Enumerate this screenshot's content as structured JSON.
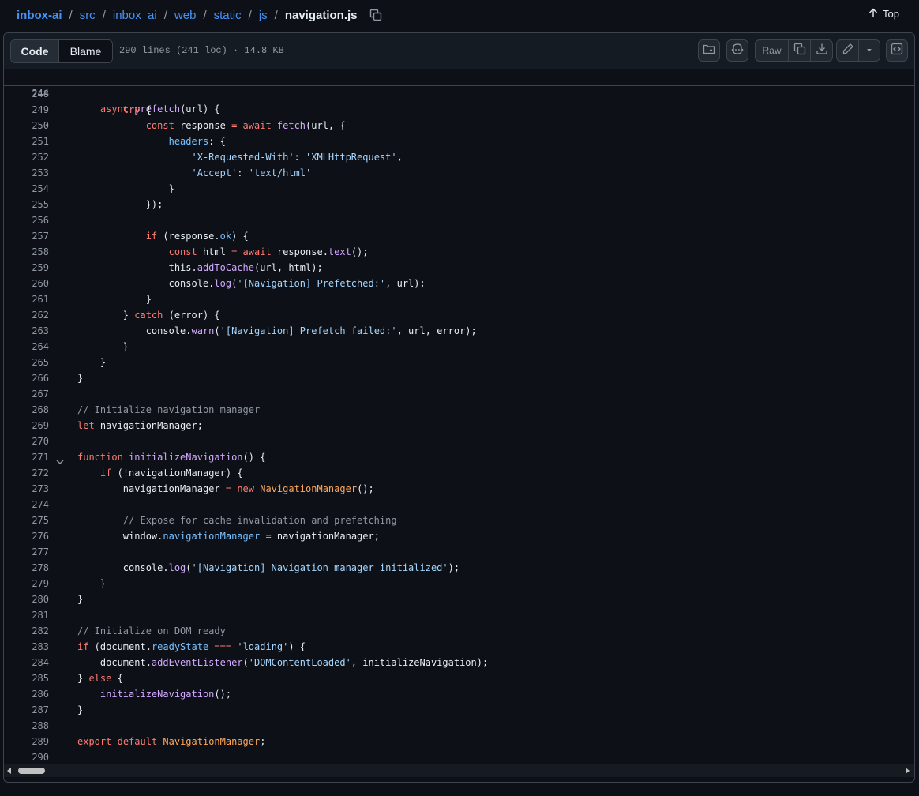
{
  "breadcrumb": {
    "repo": "inbox-ai",
    "parts": [
      "src",
      "inbox_ai",
      "web",
      "static",
      "js"
    ],
    "file": "navigation.js",
    "separator": "/"
  },
  "top_link": "Top",
  "file_header": {
    "code_tab": "Code",
    "blame_tab": "Blame",
    "meta": "290 lines (241 loc) · 14.8 KB",
    "raw_label": "Raw"
  },
  "icons": [
    "copy-path-icon",
    "arrow-up-icon",
    "file-tree-icon",
    "copilot-icon",
    "copy-raw-icon",
    "download-icon",
    "pencil-icon",
    "triangle-down-icon",
    "symbols-icon",
    "chevron-down-icon"
  ],
  "colors": {
    "background": "#0d1117",
    "keyword": "#ff7b72",
    "function": "#d2a8ff",
    "string": "#a5d6ff",
    "property": "#79c0ff",
    "comment": "#9198a1",
    "type": "#ffa657",
    "link": "#4493f8"
  },
  "sticky": {
    "num": "244",
    "tokens": [
      [
        "    ",
        ""
      ],
      [
        "async",
        "k"
      ],
      [
        " ",
        ""
      ],
      [
        "prefetch",
        "f"
      ],
      [
        "(url) {",
        ""
      ]
    ]
  },
  "code_lines": [
    {
      "num": "248",
      "tokens": []
    },
    {
      "num": "249",
      "tokens": [
        [
          "        ",
          ""
        ],
        [
          "try",
          "k"
        ],
        [
          " {",
          ""
        ]
      ]
    },
    {
      "num": "250",
      "tokens": [
        [
          "            ",
          ""
        ],
        [
          "const",
          "k"
        ],
        [
          " response ",
          ""
        ],
        [
          "=",
          "k"
        ],
        [
          " ",
          ""
        ],
        [
          "await",
          "k"
        ],
        [
          " ",
          ""
        ],
        [
          "fetch",
          "f"
        ],
        [
          "(url, {",
          ""
        ]
      ]
    },
    {
      "num": "251",
      "tokens": [
        [
          "                ",
          ""
        ],
        [
          "headers",
          "p"
        ],
        [
          ": {",
          ""
        ]
      ]
    },
    {
      "num": "252",
      "tokens": [
        [
          "                    ",
          ""
        ],
        [
          "'X-Requested-With'",
          "s"
        ],
        [
          ": ",
          ""
        ],
        [
          "'XMLHttpRequest'",
          "s"
        ],
        [
          ",",
          ""
        ]
      ]
    },
    {
      "num": "253",
      "tokens": [
        [
          "                    ",
          ""
        ],
        [
          "'Accept'",
          "s"
        ],
        [
          ": ",
          ""
        ],
        [
          "'text/html'",
          "s"
        ]
      ]
    },
    {
      "num": "254",
      "tokens": [
        [
          "                }",
          ""
        ]
      ]
    },
    {
      "num": "255",
      "tokens": [
        [
          "            });",
          ""
        ]
      ]
    },
    {
      "num": "256",
      "tokens": []
    },
    {
      "num": "257",
      "tokens": [
        [
          "            ",
          ""
        ],
        [
          "if",
          "k"
        ],
        [
          " (response.",
          ""
        ],
        [
          "ok",
          "p"
        ],
        [
          ") {",
          ""
        ]
      ]
    },
    {
      "num": "258",
      "tokens": [
        [
          "                ",
          ""
        ],
        [
          "const",
          "k"
        ],
        [
          " html ",
          ""
        ],
        [
          "=",
          "k"
        ],
        [
          " ",
          ""
        ],
        [
          "await",
          "k"
        ],
        [
          " response.",
          ""
        ],
        [
          "text",
          "f"
        ],
        [
          "();",
          ""
        ]
      ]
    },
    {
      "num": "259",
      "tokens": [
        [
          "                this.",
          ""
        ],
        [
          "addToCache",
          "f"
        ],
        [
          "(url, html);",
          ""
        ]
      ]
    },
    {
      "num": "260",
      "tokens": [
        [
          "                console.",
          ""
        ],
        [
          "log",
          "f"
        ],
        [
          "(",
          ""
        ],
        [
          "'[Navigation] Prefetched:'",
          "s"
        ],
        [
          ", url);",
          ""
        ]
      ]
    },
    {
      "num": "261",
      "tokens": [
        [
          "            }",
          ""
        ]
      ]
    },
    {
      "num": "262",
      "tokens": [
        [
          "        } ",
          ""
        ],
        [
          "catch",
          "k"
        ],
        [
          " (error) {",
          ""
        ]
      ]
    },
    {
      "num": "263",
      "tokens": [
        [
          "            console.",
          ""
        ],
        [
          "warn",
          "f"
        ],
        [
          "(",
          ""
        ],
        [
          "'[Navigation] Prefetch failed:'",
          "s"
        ],
        [
          ", url, error);",
          ""
        ]
      ]
    },
    {
      "num": "264",
      "tokens": [
        [
          "        }",
          ""
        ]
      ]
    },
    {
      "num": "265",
      "tokens": [
        [
          "    }",
          ""
        ]
      ]
    },
    {
      "num": "266",
      "tokens": [
        [
          "}",
          ""
        ]
      ]
    },
    {
      "num": "267",
      "tokens": []
    },
    {
      "num": "268",
      "tokens": [
        [
          "// Initialize navigation manager",
          "c"
        ]
      ]
    },
    {
      "num": "269",
      "tokens": [
        [
          "let",
          "k"
        ],
        [
          " navigationManager;",
          ""
        ]
      ]
    },
    {
      "num": "270",
      "tokens": []
    },
    {
      "num": "271",
      "fold": true,
      "tokens": [
        [
          "function",
          "k"
        ],
        [
          " ",
          ""
        ],
        [
          "initializeNavigation",
          "f"
        ],
        [
          "() {",
          ""
        ]
      ]
    },
    {
      "num": "272",
      "tokens": [
        [
          "    ",
          ""
        ],
        [
          "if",
          "k"
        ],
        [
          " (",
          ""
        ],
        [
          "!",
          "k"
        ],
        [
          "navigationManager) {",
          ""
        ]
      ]
    },
    {
      "num": "273",
      "tokens": [
        [
          "        navigationManager ",
          ""
        ],
        [
          "=",
          "k"
        ],
        [
          " ",
          ""
        ],
        [
          "new",
          "k"
        ],
        [
          " ",
          ""
        ],
        [
          "NavigationManager",
          "t"
        ],
        [
          "();",
          ""
        ]
      ]
    },
    {
      "num": "274",
      "tokens": []
    },
    {
      "num": "275",
      "tokens": [
        [
          "        ",
          ""
        ],
        [
          "// Expose for cache invalidation and prefetching",
          "c"
        ]
      ]
    },
    {
      "num": "276",
      "tokens": [
        [
          "        window.",
          ""
        ],
        [
          "navigationManager",
          "p"
        ],
        [
          " ",
          ""
        ],
        [
          "=",
          "k"
        ],
        [
          " navigationManager;",
          ""
        ]
      ]
    },
    {
      "num": "277",
      "tokens": []
    },
    {
      "num": "278",
      "tokens": [
        [
          "        console.",
          ""
        ],
        [
          "log",
          "f"
        ],
        [
          "(",
          ""
        ],
        [
          "'[Navigation] Navigation manager initialized'",
          "s"
        ],
        [
          ");",
          ""
        ]
      ]
    },
    {
      "num": "279",
      "tokens": [
        [
          "    }",
          ""
        ]
      ]
    },
    {
      "num": "280",
      "tokens": [
        [
          "}",
          ""
        ]
      ]
    },
    {
      "num": "281",
      "tokens": []
    },
    {
      "num": "282",
      "tokens": [
        [
          "// Initialize on DOM ready",
          "c"
        ]
      ]
    },
    {
      "num": "283",
      "tokens": [
        [
          "if",
          "k"
        ],
        [
          " (document.",
          ""
        ],
        [
          "readyState",
          "p"
        ],
        [
          " ",
          ""
        ],
        [
          "===",
          "k"
        ],
        [
          " ",
          ""
        ],
        [
          "'loading'",
          "s"
        ],
        [
          ") {",
          ""
        ]
      ]
    },
    {
      "num": "284",
      "tokens": [
        [
          "    document.",
          ""
        ],
        [
          "addEventListener",
          "f"
        ],
        [
          "(",
          ""
        ],
        [
          "'DOMContentLoaded'",
          "s"
        ],
        [
          ", initializeNavigation);",
          ""
        ]
      ]
    },
    {
      "num": "285",
      "tokens": [
        [
          "} ",
          ""
        ],
        [
          "else",
          "k"
        ],
        [
          " {",
          ""
        ]
      ]
    },
    {
      "num": "286",
      "tokens": [
        [
          "    ",
          ""
        ],
        [
          "initializeNavigation",
          "f"
        ],
        [
          "();",
          ""
        ]
      ]
    },
    {
      "num": "287",
      "tokens": [
        [
          "}",
          ""
        ]
      ]
    },
    {
      "num": "288",
      "tokens": []
    },
    {
      "num": "289",
      "tokens": [
        [
          "export",
          "k"
        ],
        [
          " ",
          ""
        ],
        [
          "default",
          "k"
        ],
        [
          " ",
          ""
        ],
        [
          "NavigationManager",
          "t"
        ],
        [
          ";",
          ""
        ]
      ]
    },
    {
      "num": "290",
      "tokens": []
    }
  ]
}
